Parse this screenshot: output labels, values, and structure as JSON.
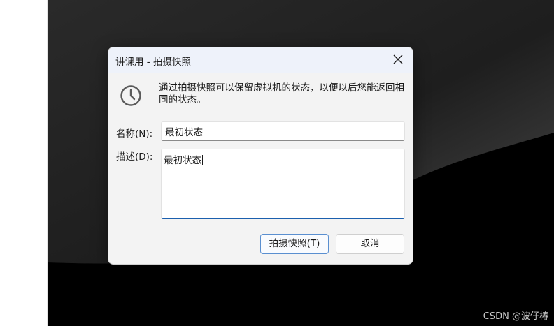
{
  "dialog": {
    "title": "讲课用 - 拍摄快照",
    "description": "通过拍摄快照可以保留虚拟机的状态，以便以后您能返回相同的状态。",
    "name_label": "名称(N):",
    "name_value": "最初状态",
    "desc_label": "描述(D):",
    "desc_value": "最初状态",
    "take_snapshot_button": "拍摄快照(T)",
    "cancel_button": "取消"
  },
  "icons": {
    "close": "close-icon",
    "clock": "clock-icon"
  },
  "watermark": "CSDN @波仔椿",
  "colors": {
    "accent": "#1b5fae",
    "dialog_bg": "#f3f3f3",
    "desktop_bg": "#000000"
  }
}
